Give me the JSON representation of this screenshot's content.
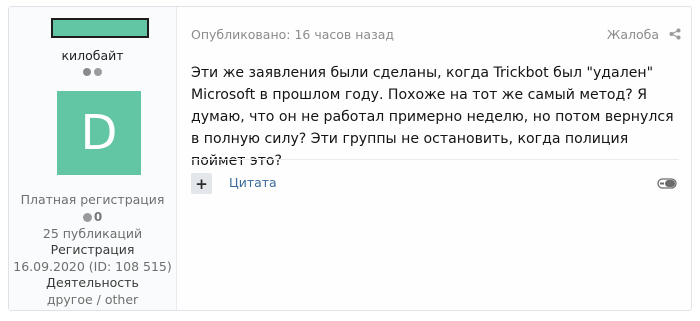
{
  "user": {
    "title": "килобайт",
    "avatar_letter": "D",
    "group": "Платная регистрация",
    "score": "0",
    "posts": "25 публикаций",
    "reg_label": "Регистрация",
    "reg_value": "16.09.2020 (ID: 108 515)",
    "activity_label": "Деятельность",
    "activity_value": "другое / other"
  },
  "post": {
    "published": "Опубликовано: 16 часов назад",
    "report_label": "Жалоба",
    "text": "Эти же заявления были сделаны, когда Trickbot был \"удален\" Microsoft в прошлом году. Похоже на тот же самый метод? Я думаю, что он не работал примерно неделю, но потом вернулся в полную силу? Эти группы не остановить, когда полиция поймет это?",
    "plus_label": "+",
    "quote_label": "Цитата"
  },
  "colors": {
    "accent": "#62c6a4",
    "link": "#3a6b9c",
    "meta": "#8c8c8c"
  },
  "icons": [
    "share-icon",
    "plus-icon",
    "toggle-icon"
  ]
}
